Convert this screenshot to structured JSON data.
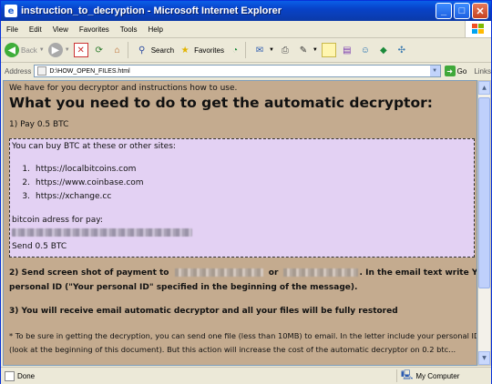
{
  "window": {
    "title": "instruction_to_decryption - Microsoft Internet Explorer",
    "minimize": "_",
    "maximize": "□",
    "close": "✕"
  },
  "menu": [
    "File",
    "Edit",
    "View",
    "Favorites",
    "Tools",
    "Help"
  ],
  "toolbar": {
    "back": "Back",
    "search": "Search",
    "favorites": "Favorites"
  },
  "address": {
    "label": "Address",
    "value": "D:\\HOW_OPEN_FILES.html",
    "go": "Go",
    "links": "Links"
  },
  "content": {
    "intro": "We have for you decryptor and instructions how to use.",
    "heading": "What you need to do to get the automatic decryptor:",
    "step1": "1) Pay 0.5 BTC",
    "box": {
      "buy_text": "You can buy BTC at these or other sites:",
      "sites": [
        "https://localbitcoins.com",
        "https://www.coinbase.com",
        "https://xchange.cc"
      ],
      "site_numbers": [
        "1.",
        "2.",
        "3."
      ],
      "address_label": "bitcoin adress for pay:",
      "send": "Send 0.5 BTC"
    },
    "step2_a": "2) Send screen shot of payment to",
    "step2_or": "or",
    "step2_b": ". In the email text write Your",
    "step2_c": "personal ID (\"Your personal ID\" specified in the beginning of the message).",
    "step3": "3) You will receive email automatic decryptor and all your files will be fully restored",
    "note1": "* To be sure in getting the decryption, you can send one file (less than 10MB) to email. In the letter include your personal ID",
    "note2": "(look at the beginning of this document). But this action will increase the cost of the automatic decryptor on 0.2 btc..."
  },
  "status": {
    "left": "Done",
    "zone": "My Computer"
  },
  "colors": {
    "content_bg": "#c4ab8f",
    "box_bg": "#e3d1f3",
    "title_bar": "#0842c8"
  }
}
